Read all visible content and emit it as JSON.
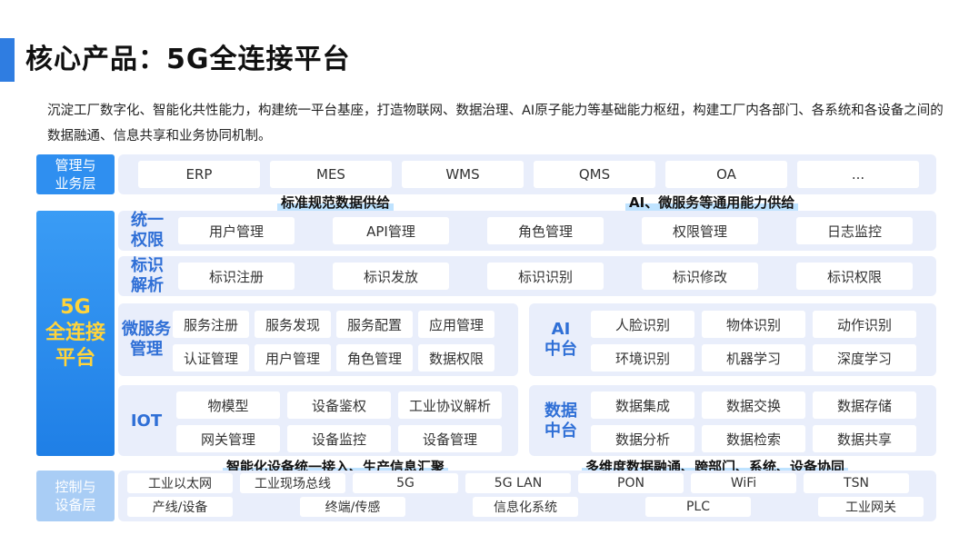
{
  "title": "核心产品：5G全连接平台",
  "description": "沉淀工厂数字化、智能化共性能力，构建统一平台基座，打造物联网、数据治理、AI原子能力等基础能力枢纽，构建工厂内各部门、各系统和各设备之间的数据融通、信息共享和业务协同机制。",
  "mgmt": {
    "label": "管理与\n业务层",
    "items": [
      "ERP",
      "MES",
      "WMS",
      "QMS",
      "OA",
      "..."
    ]
  },
  "banners": {
    "top_left": "标准规范数据供给",
    "top_right": "AI、微服务等通用能力供给",
    "bottom_left": "智能化设备统一接入、生产信息汇聚",
    "bottom_right": "多维度数据融通、跨部门、系统、设备协同"
  },
  "platform": {
    "label": "5G\n全连接\n平台",
    "auth": {
      "label": "统一\n权限",
      "items": [
        "用户管理",
        "API管理",
        "角色管理",
        "权限管理",
        "日志监控"
      ]
    },
    "ident": {
      "label": "标识\n解析",
      "items": [
        "标识注册",
        "标识发放",
        "标识识别",
        "标识修改",
        "标识权限"
      ]
    },
    "micro": {
      "label": "微服务\n管理",
      "items": [
        "服务注册",
        "服务发现",
        "服务配置",
        "应用管理",
        "认证管理",
        "用户管理",
        "角色管理",
        "数据权限"
      ]
    },
    "ai": {
      "label": "AI\n中台",
      "items": [
        "人脸识别",
        "物体识别",
        "动作识别",
        "环境识别",
        "机器学习",
        "深度学习"
      ]
    },
    "iot": {
      "label": "IOT",
      "items": [
        "物模型",
        "设备鉴权",
        "工业协议解析",
        "网关管理",
        "设备监控",
        "设备管理"
      ]
    },
    "data": {
      "label": "数据\n中台",
      "items": [
        "数据集成",
        "数据交换",
        "数据存储",
        "数据分析",
        "数据检索",
        "数据共享"
      ]
    }
  },
  "control": {
    "label": "控制与\n设备层",
    "row1": [
      "工业以太网",
      "工业现场总线",
      "5G",
      "5G LAN",
      "PON",
      "WiFi",
      "TSN"
    ],
    "row2": [
      "产线/设备",
      "终端/传感",
      "信息化系统",
      "PLC",
      "工业网关"
    ]
  },
  "colors": {
    "accent": "#2f8ff0",
    "highlight": "#ffd43b",
    "band": "#e9eefb",
    "row_label": "#2f6fd6"
  }
}
